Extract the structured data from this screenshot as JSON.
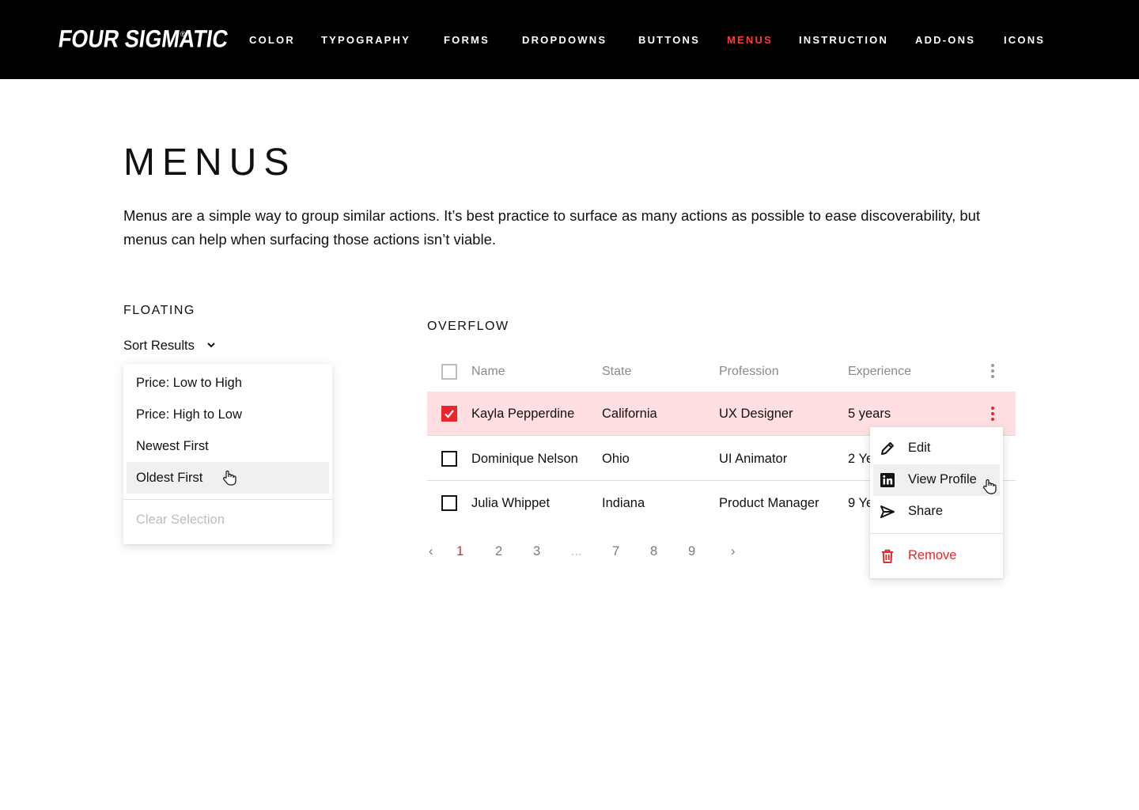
{
  "header": {
    "logo_text": "FOUR SIGMATIC",
    "logo_mark": "®",
    "nav": [
      {
        "label": "COLOR"
      },
      {
        "label": "TYPOGRAPHY"
      },
      {
        "label": "FORMS"
      },
      {
        "label": "DROPDOWNS"
      },
      {
        "label": "BUTTONS"
      },
      {
        "label": "MENUS"
      },
      {
        "label": "INSTRUCTION"
      },
      {
        "label": "ADD-ONS"
      },
      {
        "label": "ICONS"
      }
    ],
    "active_nav": "MENUS"
  },
  "page": {
    "title": "MENUS",
    "intro": "Menus are a simple way to group similar actions. It’s best practice to surface as many actions as possible to ease discoverability, but menus can help when surfacing those actions isn’t viable."
  },
  "floating": {
    "label": "FLOATING",
    "trigger": "Sort Results",
    "options": [
      "Price: Low to High",
      "Price: High to Low",
      "Newest First",
      "Oldest First"
    ],
    "hovered_option": "Oldest First",
    "clear": "Clear Selection"
  },
  "overflow": {
    "label": "OVERFLOW",
    "columns": [
      "Name",
      "State",
      "Profession",
      "Experience"
    ],
    "rows": [
      {
        "name": "Kayla Pepperdine",
        "state": "California",
        "profession": "UX Designer",
        "experience": "5 years",
        "checked": true
      },
      {
        "name": "Dominique Nelson",
        "state": "Ohio",
        "profession": "UI Animator",
        "experience": "2 Ye",
        "checked": false
      },
      {
        "name": "Julia Whippet",
        "state": "Indiana",
        "profession": "Product Manager",
        "experience": "9 Ye",
        "checked": false
      }
    ],
    "pagination": {
      "prev": "‹",
      "pages": [
        "1",
        "2",
        "3",
        "...",
        "7",
        "8",
        "9"
      ],
      "current": "1",
      "next": "›"
    },
    "menu": {
      "items": [
        {
          "label": "Edit",
          "icon": "pencil-icon"
        },
        {
          "label": "View Profile",
          "icon": "linkedin-icon"
        },
        {
          "label": "Share",
          "icon": "send-icon"
        }
      ],
      "hovered_item": "View Profile",
      "danger": {
        "label": "Remove",
        "icon": "trash-icon"
      }
    }
  },
  "colors": {
    "accent": "#e8262c",
    "nav_active": "#ff3b3b",
    "selected_row": "#ffdfe1",
    "header_bg": "#000000"
  }
}
